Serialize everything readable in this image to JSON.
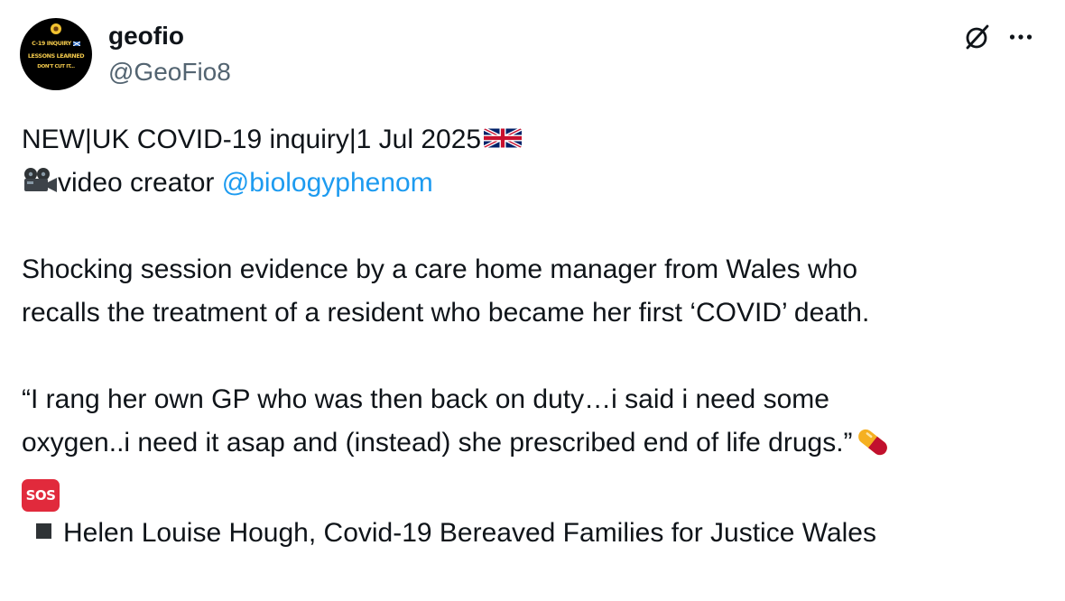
{
  "author": {
    "display_name": "geofio",
    "handle": "@GeoFio8",
    "avatar_lines": [
      "C-19 INQUIRY",
      "LESSONS LEARNED",
      "DON'T CUT IT..."
    ]
  },
  "header_actions": {
    "grok_icon": "grok-slash-circle-icon",
    "more_icon": "more-horizontal-icon"
  },
  "post": {
    "line1_text": "NEW|UK COVID-19 inquiry|1 Jul 2025",
    "line2_text": "video creator ",
    "line2_mention": "@biologyphenom",
    "para1_line1": "Shocking session evidence by a care home manager from Wales who",
    "para1_line2": "recalls the treatment of a resident who became her first ‘COVID’ death.",
    "quote_line1": "“I rang her own GP who was then back on duty…i said i need some",
    "quote_line2": "oxygen..i need it asap and (instead) she prescribed end of life drugs.”",
    "sos_text": "SOS",
    "bullet_text": "Helen Louise Hough, Covid-19 Bereaved Families for Justice Wales"
  },
  "emoji": {
    "flag": "uk-flag-emoji",
    "camera": "movie-camera-emoji",
    "pill": "pill-emoji",
    "sos": "sos-button-emoji"
  },
  "colors": {
    "text": "#0f1419",
    "secondary": "#536471",
    "link": "#1d9bf0",
    "sos_red": "#e12a3c"
  }
}
